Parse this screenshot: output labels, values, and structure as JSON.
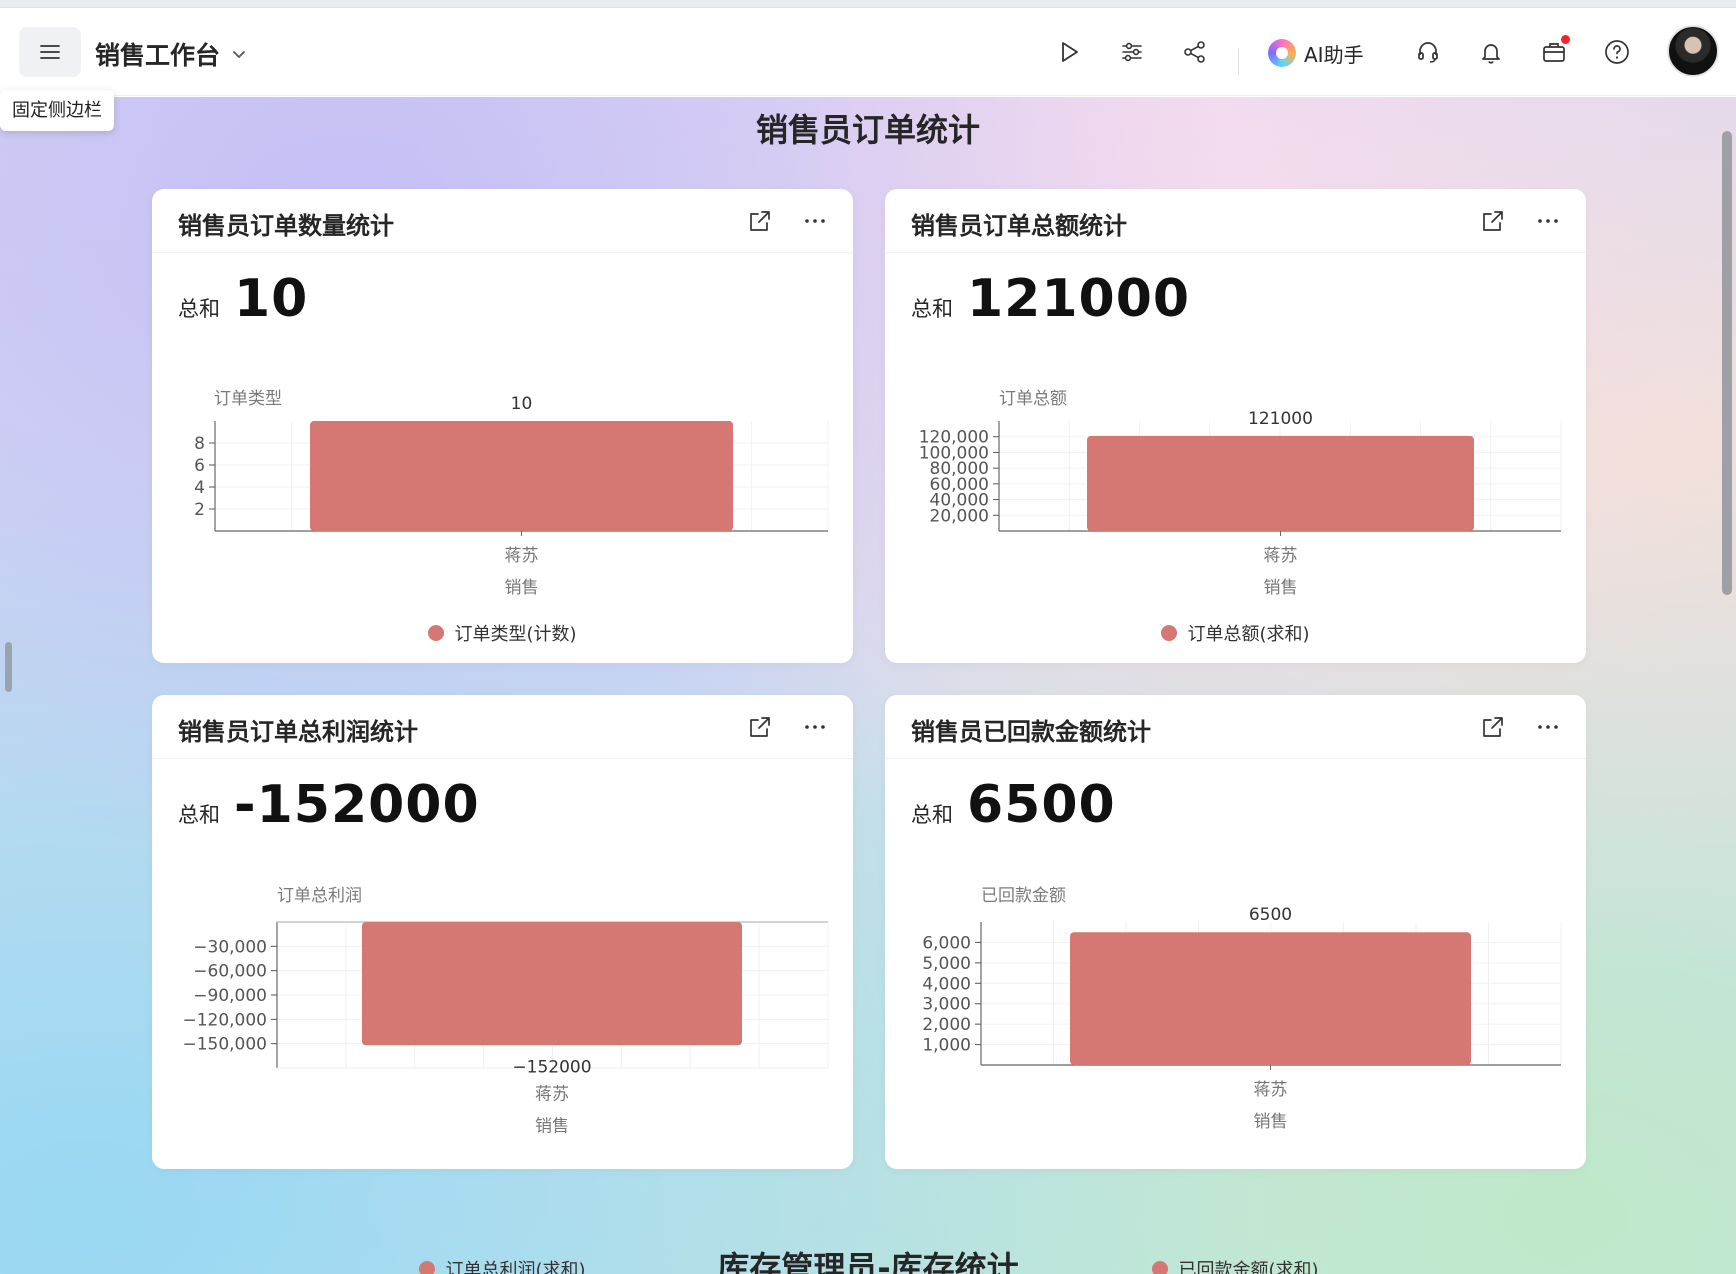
{
  "header": {
    "app_title": "销售工作台",
    "tooltip": "固定侧边栏",
    "ai_label": "AI助手",
    "icons": [
      "menu-icon",
      "chevron-down-icon",
      "play-icon",
      "sliders-icon",
      "share-icon",
      "ai-assistant-icon",
      "headset-icon",
      "bell-icon",
      "briefcase-icon",
      "help-icon"
    ]
  },
  "page": {
    "section_title": "销售员订单统计",
    "next_section_title": "库存管理员-库存统计"
  },
  "colors": {
    "bar": "#d57772",
    "accent_dot": "#f5222d"
  },
  "cards": [
    {
      "title": "销售员订单数量统计",
      "kpi_label": "总和",
      "kpi_value": "10",
      "chart_data": {
        "type": "bar",
        "ylabel": "订单类型",
        "categories": [
          [
            "蒋苏",
            "销售"
          ]
        ],
        "values": [
          10
        ],
        "value_label": "10",
        "yticks": [
          "8",
          "6",
          "4",
          "2"
        ],
        "ylim": [
          0,
          10
        ],
        "legend": "订单类型(计数)",
        "grid": true
      }
    },
    {
      "title": "销售员订单总额统计",
      "kpi_label": "总和",
      "kpi_value": "121000",
      "chart_data": {
        "type": "bar",
        "ylabel": "订单总额",
        "categories": [
          [
            "蒋苏",
            "销售"
          ]
        ],
        "values": [
          121000
        ],
        "value_label": "121000",
        "yticks": [
          "120,000",
          "100,000",
          "80,000",
          "60,000",
          "40,000",
          "20,000"
        ],
        "ylim": [
          0,
          140000
        ],
        "legend": "订单总额(求和)",
        "grid": true
      }
    },
    {
      "title": "销售员订单总利润统计",
      "kpi_label": "总和",
      "kpi_value": "-152000",
      "chart_data": {
        "type": "bar",
        "ylabel": "订单总利润",
        "categories": [
          [
            "蒋苏",
            "销售"
          ]
        ],
        "values": [
          -152000
        ],
        "value_label": "−152000",
        "yticks": [
          "−30,000",
          "−60,000",
          "−90,000",
          "−120,000",
          "−150,000"
        ],
        "ylim": [
          -180000,
          0
        ],
        "legend": "订单总利润(求和)",
        "grid": true
      }
    },
    {
      "title": "销售员已回款金额统计",
      "kpi_label": "总和",
      "kpi_value": "6500",
      "chart_data": {
        "type": "bar",
        "ylabel": "已回款金额",
        "categories": [
          [
            "蒋苏",
            "销售"
          ]
        ],
        "values": [
          6500
        ],
        "value_label": "6500",
        "yticks": [
          "6,000",
          "5,000",
          "4,000",
          "3,000",
          "2,000",
          "1,000"
        ],
        "ylim": [
          0,
          7000
        ],
        "legend": "已回款金额(求和)",
        "grid": true
      }
    }
  ]
}
